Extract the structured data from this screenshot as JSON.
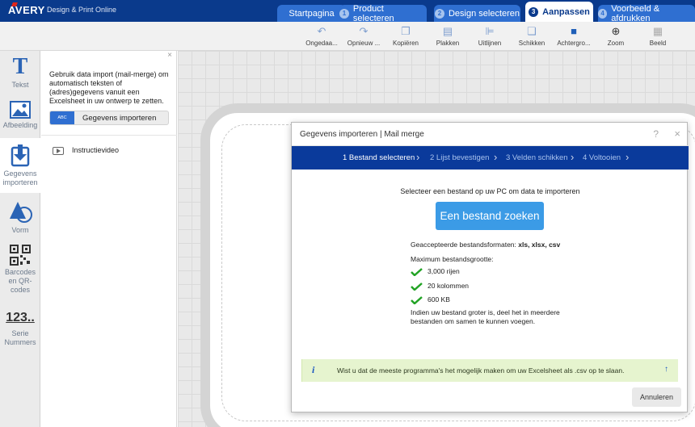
{
  "brand": {
    "logo": "AVERY",
    "subtitle": "Design & Print Online"
  },
  "tabs": [
    {
      "num": "",
      "label": "Startpagina"
    },
    {
      "num": "1",
      "label": "Product selecteren"
    },
    {
      "num": "2",
      "label": "Design selecteren"
    },
    {
      "num": "3",
      "label": "Aanpassen"
    },
    {
      "num": "4",
      "label": "Voorbeeld & afdrukken"
    }
  ],
  "toolbar": [
    {
      "icon": "undo-icon",
      "label": "Ongedaa..."
    },
    {
      "icon": "redo-icon",
      "label": "Opnieuw ..."
    },
    {
      "icon": "copy-icon",
      "label": "Kopiëren"
    },
    {
      "icon": "paste-icon",
      "label": "Plakken"
    },
    {
      "icon": "align-icon",
      "label": "Uitlijnen"
    },
    {
      "icon": "arrange-icon",
      "label": "Schikken"
    },
    {
      "icon": "background-icon",
      "label": "Achtergro..."
    },
    {
      "icon": "zoom-icon",
      "label": "Zoom"
    },
    {
      "icon": "grid-icon",
      "label": "Beeld"
    }
  ],
  "rail": {
    "text": "Tekst",
    "image": "Afbeelding",
    "import": "Gegevens importeren",
    "shape": "Vorm",
    "barcodes": "Barcodes en QR-codes",
    "serial_icon": "123..",
    "serial": "Serie Nummers"
  },
  "panel": {
    "close": "×",
    "description": "Gebruik data import (mail-merge) om automatisch teksten of (adres)gegevens vanuit een Excelsheet in uw ontwerp te zetten.",
    "badge": "ABC",
    "import_button": "Gegevens importeren",
    "video": "Instructievideo"
  },
  "modal": {
    "title": "Gegevens importeren | Mail merge",
    "help": "?",
    "close": "×",
    "steps": [
      "1 Bestand selecteren",
      "2 Lijst bevestigen",
      "3 Velden schikken",
      "4 Voltooien"
    ],
    "intro": "Selecteer een bestand op uw PC om data te importeren",
    "find_button": "Een bestand zoeken",
    "formats_label": "Geaccepteerde bestandsformaten:",
    "formats_value": "xls, xlsx, csv",
    "max_label": "Maximum bestandsgrootte:",
    "limits": [
      "3,000 rijen",
      "20 kolommen",
      "600 KB"
    ],
    "note": "Indien uw bestand groter is, deel het in meerdere bestanden om samen te kunnen voegen.",
    "tip": "Wist u dat de meeste programma's het mogelijk maken om uw Excelsheet als .csv op te slaan.",
    "cancel": "Annuleren"
  },
  "colors": {
    "primary": "#0a3a8c",
    "accent": "#3b9be6",
    "check": "#22a325",
    "tip_bg": "#e6f4cf"
  }
}
